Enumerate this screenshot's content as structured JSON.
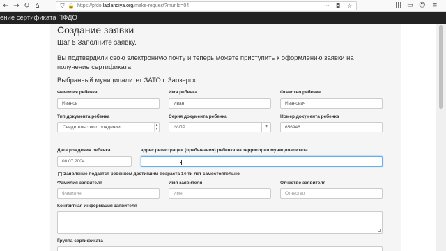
{
  "browser": {
    "url_prefix": "https://pfdo.",
    "url_domain": "laplandiya.org",
    "url_path": "/make-request?munId=04",
    "nav_icons": [
      "back-icon",
      "forward-icon",
      "reload-icon",
      "home-icon"
    ],
    "url_icons": [
      "shield-icon",
      "lock-icon"
    ],
    "url_right_icons": [
      "more-dots-icon",
      "pocket-icon",
      "star-icon"
    ],
    "toolbar_right_icons": [
      "library-icon",
      "reader-view-icon",
      "sync-icon",
      "menu-icon"
    ]
  },
  "navbar": {
    "title": "ение сертификата ПФДО"
  },
  "page": {
    "title": "Создание заявки",
    "step": "Шаг 5 Заполните заявку.",
    "intro": "Вы подтвердили свою электронную почту и теперь можете приступить к оформлению заявки на получение сертификата.",
    "municipality": "Выбранный муниципалитет ЗАТО г. Заозерск"
  },
  "form": {
    "child_last_name": {
      "label": "Фамилия ребенка",
      "value": "Иванов"
    },
    "child_first_name": {
      "label": "Имя ребенка",
      "value": "Иван"
    },
    "child_patronymic": {
      "label": "Отчество ребенка",
      "value": "Иванович"
    },
    "doc_type": {
      "label": "Тип документа ребенка",
      "value": "Свидетельство о рождении"
    },
    "doc_series": {
      "label": "Серия документа ребенка",
      "value": "IV-ПР",
      "help": "?"
    },
    "doc_number": {
      "label": "Номер документа ребенка",
      "value": "656946"
    },
    "birth_date": {
      "label": "Дата рождения ребенка",
      "value": "08.07.2004"
    },
    "address": {
      "label": "адрес регистрации (пребывания) ребенка на территории муниципалитета",
      "value": ""
    },
    "self_checkbox": {
      "label": "Заявление подается ребенком достигшим возраста 14-ти лет самостоятельно",
      "checked": false
    },
    "applicant_last_name": {
      "label": "Фамилия заявителя",
      "placeholder": "Фамилия"
    },
    "applicant_first_name": {
      "label": "Имя заявителя",
      "placeholder": "Имя"
    },
    "applicant_patronymic": {
      "label": "Отчество заявителя",
      "placeholder": "Отчество"
    },
    "contact_info": {
      "label": "Контактная информация заявителя",
      "value": ""
    },
    "certificate_group": {
      "label": "Группа сертификата"
    }
  }
}
